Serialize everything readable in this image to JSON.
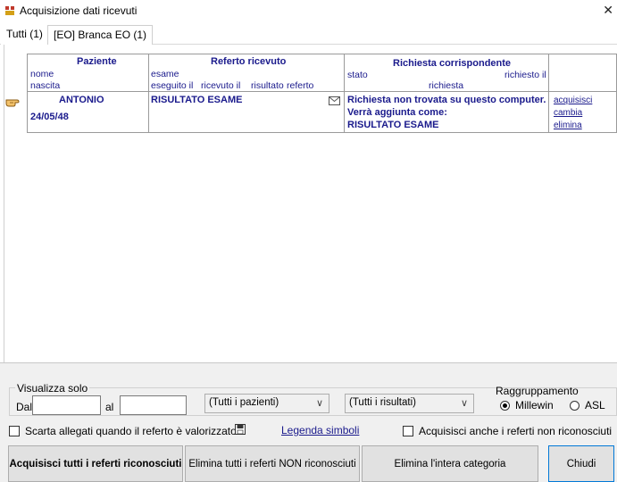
{
  "window": {
    "title": "Acquisizione dati ricevuti",
    "close_glyph": "✕"
  },
  "tabs": [
    {
      "label": "Tutti (1)"
    },
    {
      "label": "[EO] Branca EO (1)"
    }
  ],
  "table": {
    "headers": {
      "paziente": "Paziente",
      "referto": "Referto ricevuto",
      "richiesta": "Richiesta corrispondente"
    },
    "subheaders": {
      "nome": "nome",
      "nascita": "nascita",
      "esame": "esame",
      "eseguito": "eseguito il",
      "ricevuto": "ricevuto il",
      "risultato": "risultato",
      "referto": "referto",
      "stato": "stato",
      "richiesto_il": "richiesto il",
      "richiesta": "richiesta"
    },
    "row": {
      "nome": "ANTONIO",
      "nascita": "24/05/48",
      "esame": "RISULTATO ESAME",
      "stato_line1": "Richiesta non trovata su questo computer.",
      "stato_line2": "Verrà aggiunta come:",
      "stato_line3": "RISULTATO ESAME",
      "actions": [
        "acquisisci",
        "cambia",
        "elimina"
      ]
    }
  },
  "filters": {
    "group_label": "Visualizza solo",
    "dal_label": "Dal",
    "al_label": "al",
    "dal_value": "",
    "al_value": "",
    "pazienti_selected": "(Tutti i pazienti)",
    "risultati_selected": "(Tutti i risultati)",
    "grouping_label": "Raggruppamento",
    "grouping_options": [
      "Millewin",
      "ASL"
    ],
    "grouping_selected": "Millewin"
  },
  "options": {
    "scarta_label": "Scarta allegati quando il referto è valorizzato",
    "legenda_label": "Legenda simboli",
    "acquisisci_nonric_label": "Acquisisci anche i referti non riconosciuti"
  },
  "buttons": {
    "acquisisci_tutti": "Acquisisci tutti i referti riconosciuti",
    "elimina_non_ric": "Elimina tutti i referti NON riconosciuti",
    "elimina_categoria": "Elimina l'intera categoria",
    "chiudi": "Chiudi"
  },
  "icons": {
    "app": "app-icon",
    "pointer": "hand-pointer-icon",
    "mail": "envelope-icon",
    "save": "floppy-disk-icon"
  }
}
